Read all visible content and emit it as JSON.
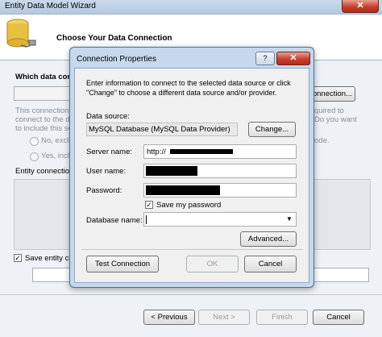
{
  "wizard": {
    "title": "Entity Data Model Wizard",
    "close_glyph": "✕",
    "header_title": "Choose Your Data Connection",
    "which_data_label": "Which data conn",
    "new_connection_label": "Connection...",
    "info_line1": "This connection s",
    "info_line1_right": "quired to",
    "info_line2": "connect to the da",
    "info_line2_right": "Do you want",
    "info_line3": "to include this se",
    "radio_no_label": "No, exclu",
    "radio_no_right": "ode.",
    "radio_yes_label": "Yes, inclu",
    "entity_conn_label": "Entity connection",
    "save_entity_label": "Save entity co",
    "save_entity_checked": true,
    "buttons": {
      "previous": "< Previous",
      "next": "Next >",
      "finish": "Finish",
      "cancel": "Cancel"
    }
  },
  "dialog": {
    "title": "Connection Properties",
    "help_glyph": "?",
    "close_glyph": "✕",
    "instructions": [
      "Enter information to connect to the selected data source or click",
      "\"Change\" to choose a different data source and/or provider."
    ],
    "data_source_label": "Data source:",
    "data_source_value": "MySQL Database (MySQL Data Provider)",
    "change_button": "Change...",
    "server_name_label": "Server name:",
    "server_name_value": "http://",
    "user_name_label": "User name:",
    "password_label": "Password:",
    "save_password_label": "Save my password",
    "save_password_checked": true,
    "database_name_label": "Database name:",
    "database_name_value": "",
    "dropdown_glyph": "▼",
    "advanced_button": "Advanced...",
    "test_connection_button": "Test Connection",
    "ok_button": "OK",
    "cancel_button": "Cancel"
  }
}
